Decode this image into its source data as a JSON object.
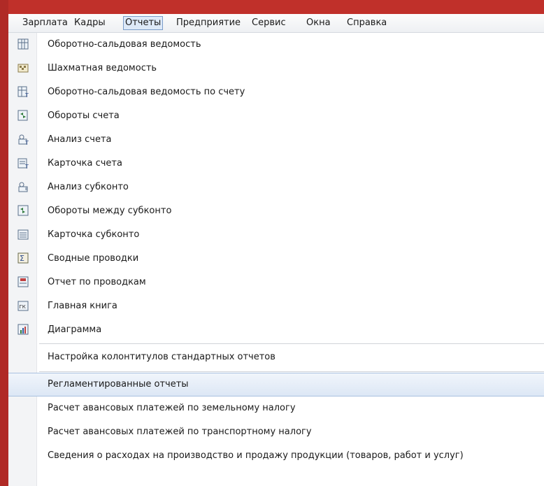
{
  "menubar": {
    "items": [
      {
        "label": "Зарплата"
      },
      {
        "label": "Кадры"
      },
      {
        "label": "Отчеты"
      },
      {
        "label": "Предприятие"
      },
      {
        "label": "Сервис"
      },
      {
        "label": "Окна"
      },
      {
        "label": "Справка"
      }
    ]
  },
  "menu": {
    "items": [
      {
        "label": "Оборотно-сальдовая ведомость",
        "icon": "turnover-balance-icon"
      },
      {
        "label": "Шахматная ведомость",
        "icon": "chess-sheet-icon"
      },
      {
        "label": "Оборотно-сальдовая ведомость по счету",
        "icon": "account-turnover-balance-icon"
      },
      {
        "label": "Обороты счета",
        "icon": "account-turnover-icon"
      },
      {
        "label": "Анализ счета",
        "icon": "account-analysis-icon"
      },
      {
        "label": "Карточка счета",
        "icon": "account-card-icon"
      },
      {
        "label": "Анализ субконто",
        "icon": "subconto-analysis-icon"
      },
      {
        "label": "Обороты между субконто",
        "icon": "subconto-turnover-icon"
      },
      {
        "label": "Карточка субконто",
        "icon": "subconto-card-icon"
      },
      {
        "label": "Сводные проводки",
        "icon": "summary-entries-icon"
      },
      {
        "label": "Отчет по проводкам",
        "icon": "entries-report-icon"
      },
      {
        "label": "Главная книга",
        "icon": "general-ledger-icon"
      },
      {
        "label": "Диаграмма",
        "icon": "chart-icon"
      }
    ],
    "settings_item": {
      "label": "Настройка колонтитулов стандартных отчетов"
    },
    "regulated_item": {
      "label": "Регламентированные отчеты"
    },
    "extra_items": [
      {
        "label": "Расчет авансовых платежей по земельному налогу"
      },
      {
        "label": "Расчет авансовых платежей по транспортному налогу"
      },
      {
        "label": "Сведения о расходах на производство и продажу продукции (товаров, работ и услуг)"
      }
    ]
  },
  "colors": {
    "frame": "#c0302a",
    "highlight": "#dce7f5",
    "highlight_border": "#a9c1e0"
  }
}
